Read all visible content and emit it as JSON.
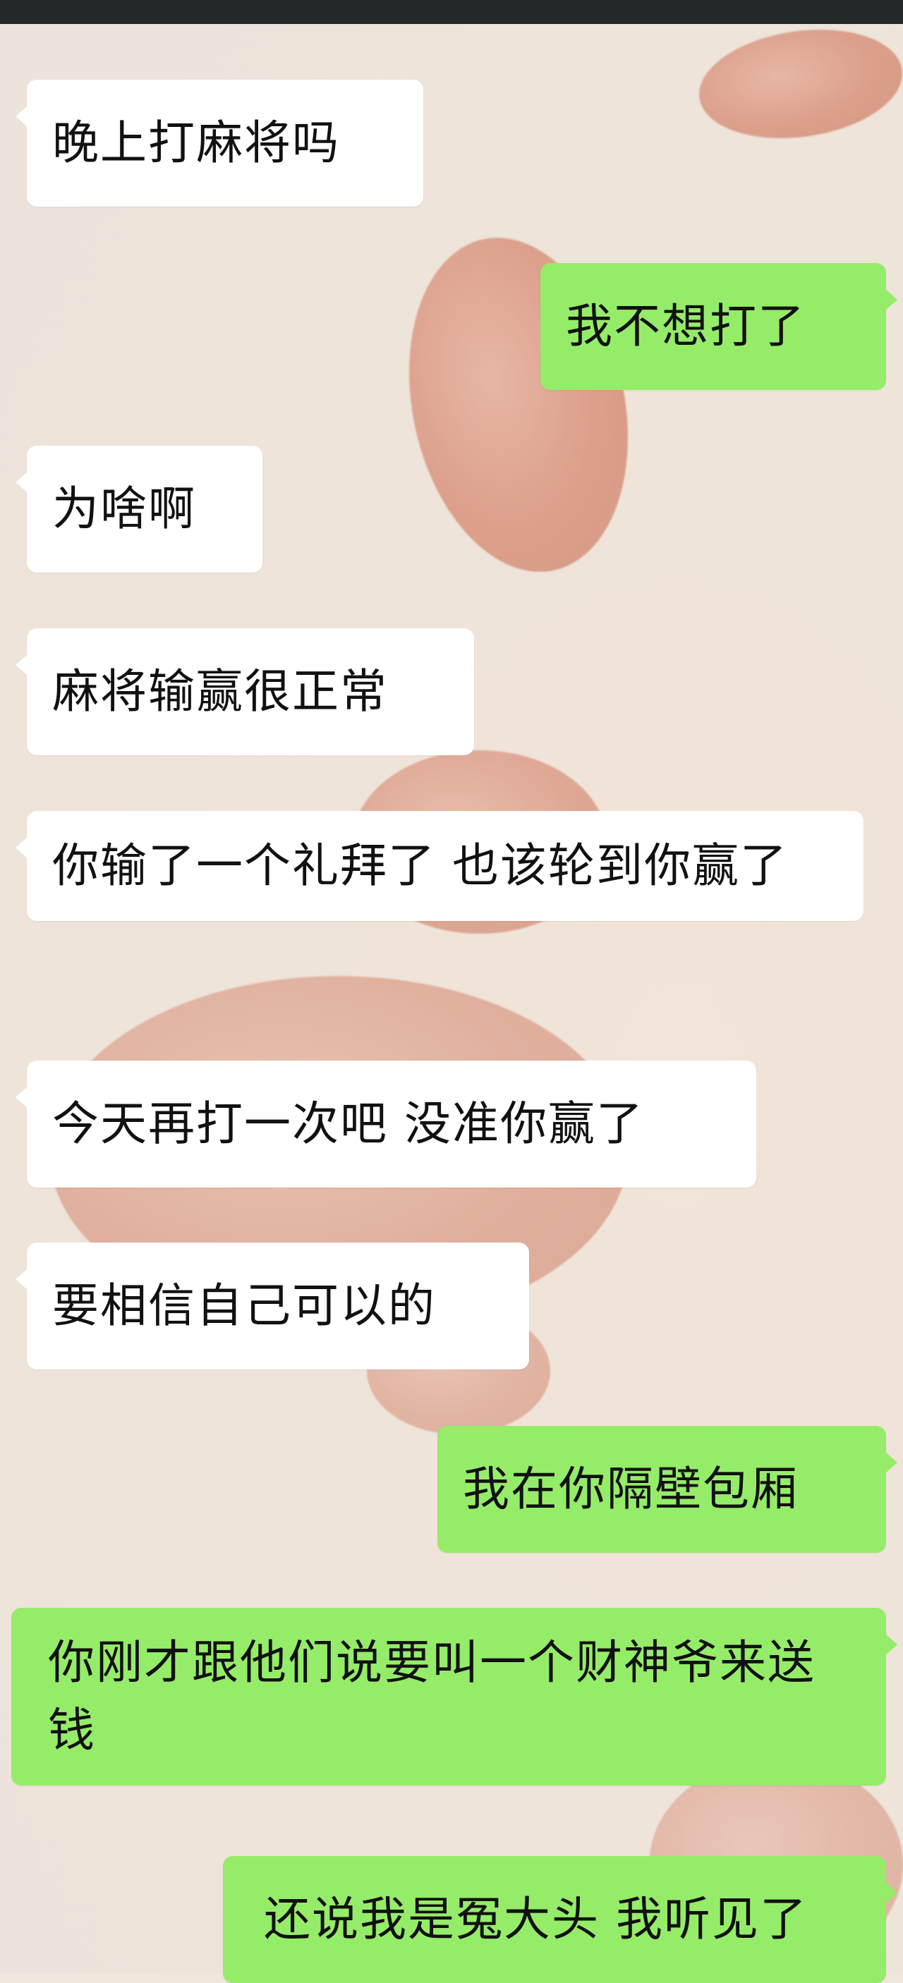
{
  "chat": {
    "messages": [
      {
        "side": "in",
        "text": "晚上打麻将吗"
      },
      {
        "side": "out",
        "text": "我不想打了"
      },
      {
        "side": "in",
        "text": "为啥啊"
      },
      {
        "side": "in",
        "text": "麻将输赢很正常"
      },
      {
        "side": "in",
        "text": "你输了一个礼拜了 也该轮到你赢了"
      },
      {
        "side": "in",
        "text": "今天再打一次吧 没准你赢了"
      },
      {
        "side": "in",
        "text": "要相信自己可以的"
      },
      {
        "side": "out",
        "text": "我在你隔壁包厢"
      },
      {
        "side": "out",
        "text": "你刚才跟他们说要叫一个财神爷来送钱"
      },
      {
        "side": "out",
        "text": "还说我是冤大头 我听见了"
      }
    ]
  },
  "colors": {
    "incoming_bubble": "#ffffff",
    "outgoing_bubble": "#95ec69",
    "top_bar": "#23282a"
  }
}
